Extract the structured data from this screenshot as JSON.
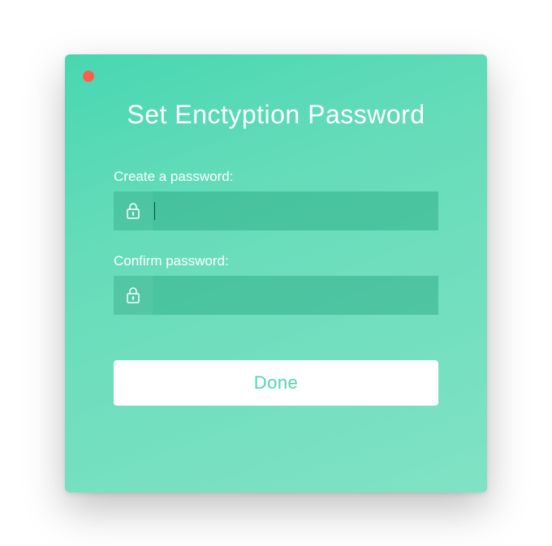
{
  "window": {
    "title": "Set Enctyption Password",
    "close_color": "#ff5e4d",
    "bg_gradient_start": "#48d7b2",
    "bg_gradient_end": "#80e2c4"
  },
  "form": {
    "create": {
      "label": "Create a password:",
      "value": "",
      "icon": "lock-icon"
    },
    "confirm": {
      "label": "Confirm password:",
      "value": "",
      "icon": "lock-icon"
    }
  },
  "actions": {
    "done_label": "Done"
  }
}
